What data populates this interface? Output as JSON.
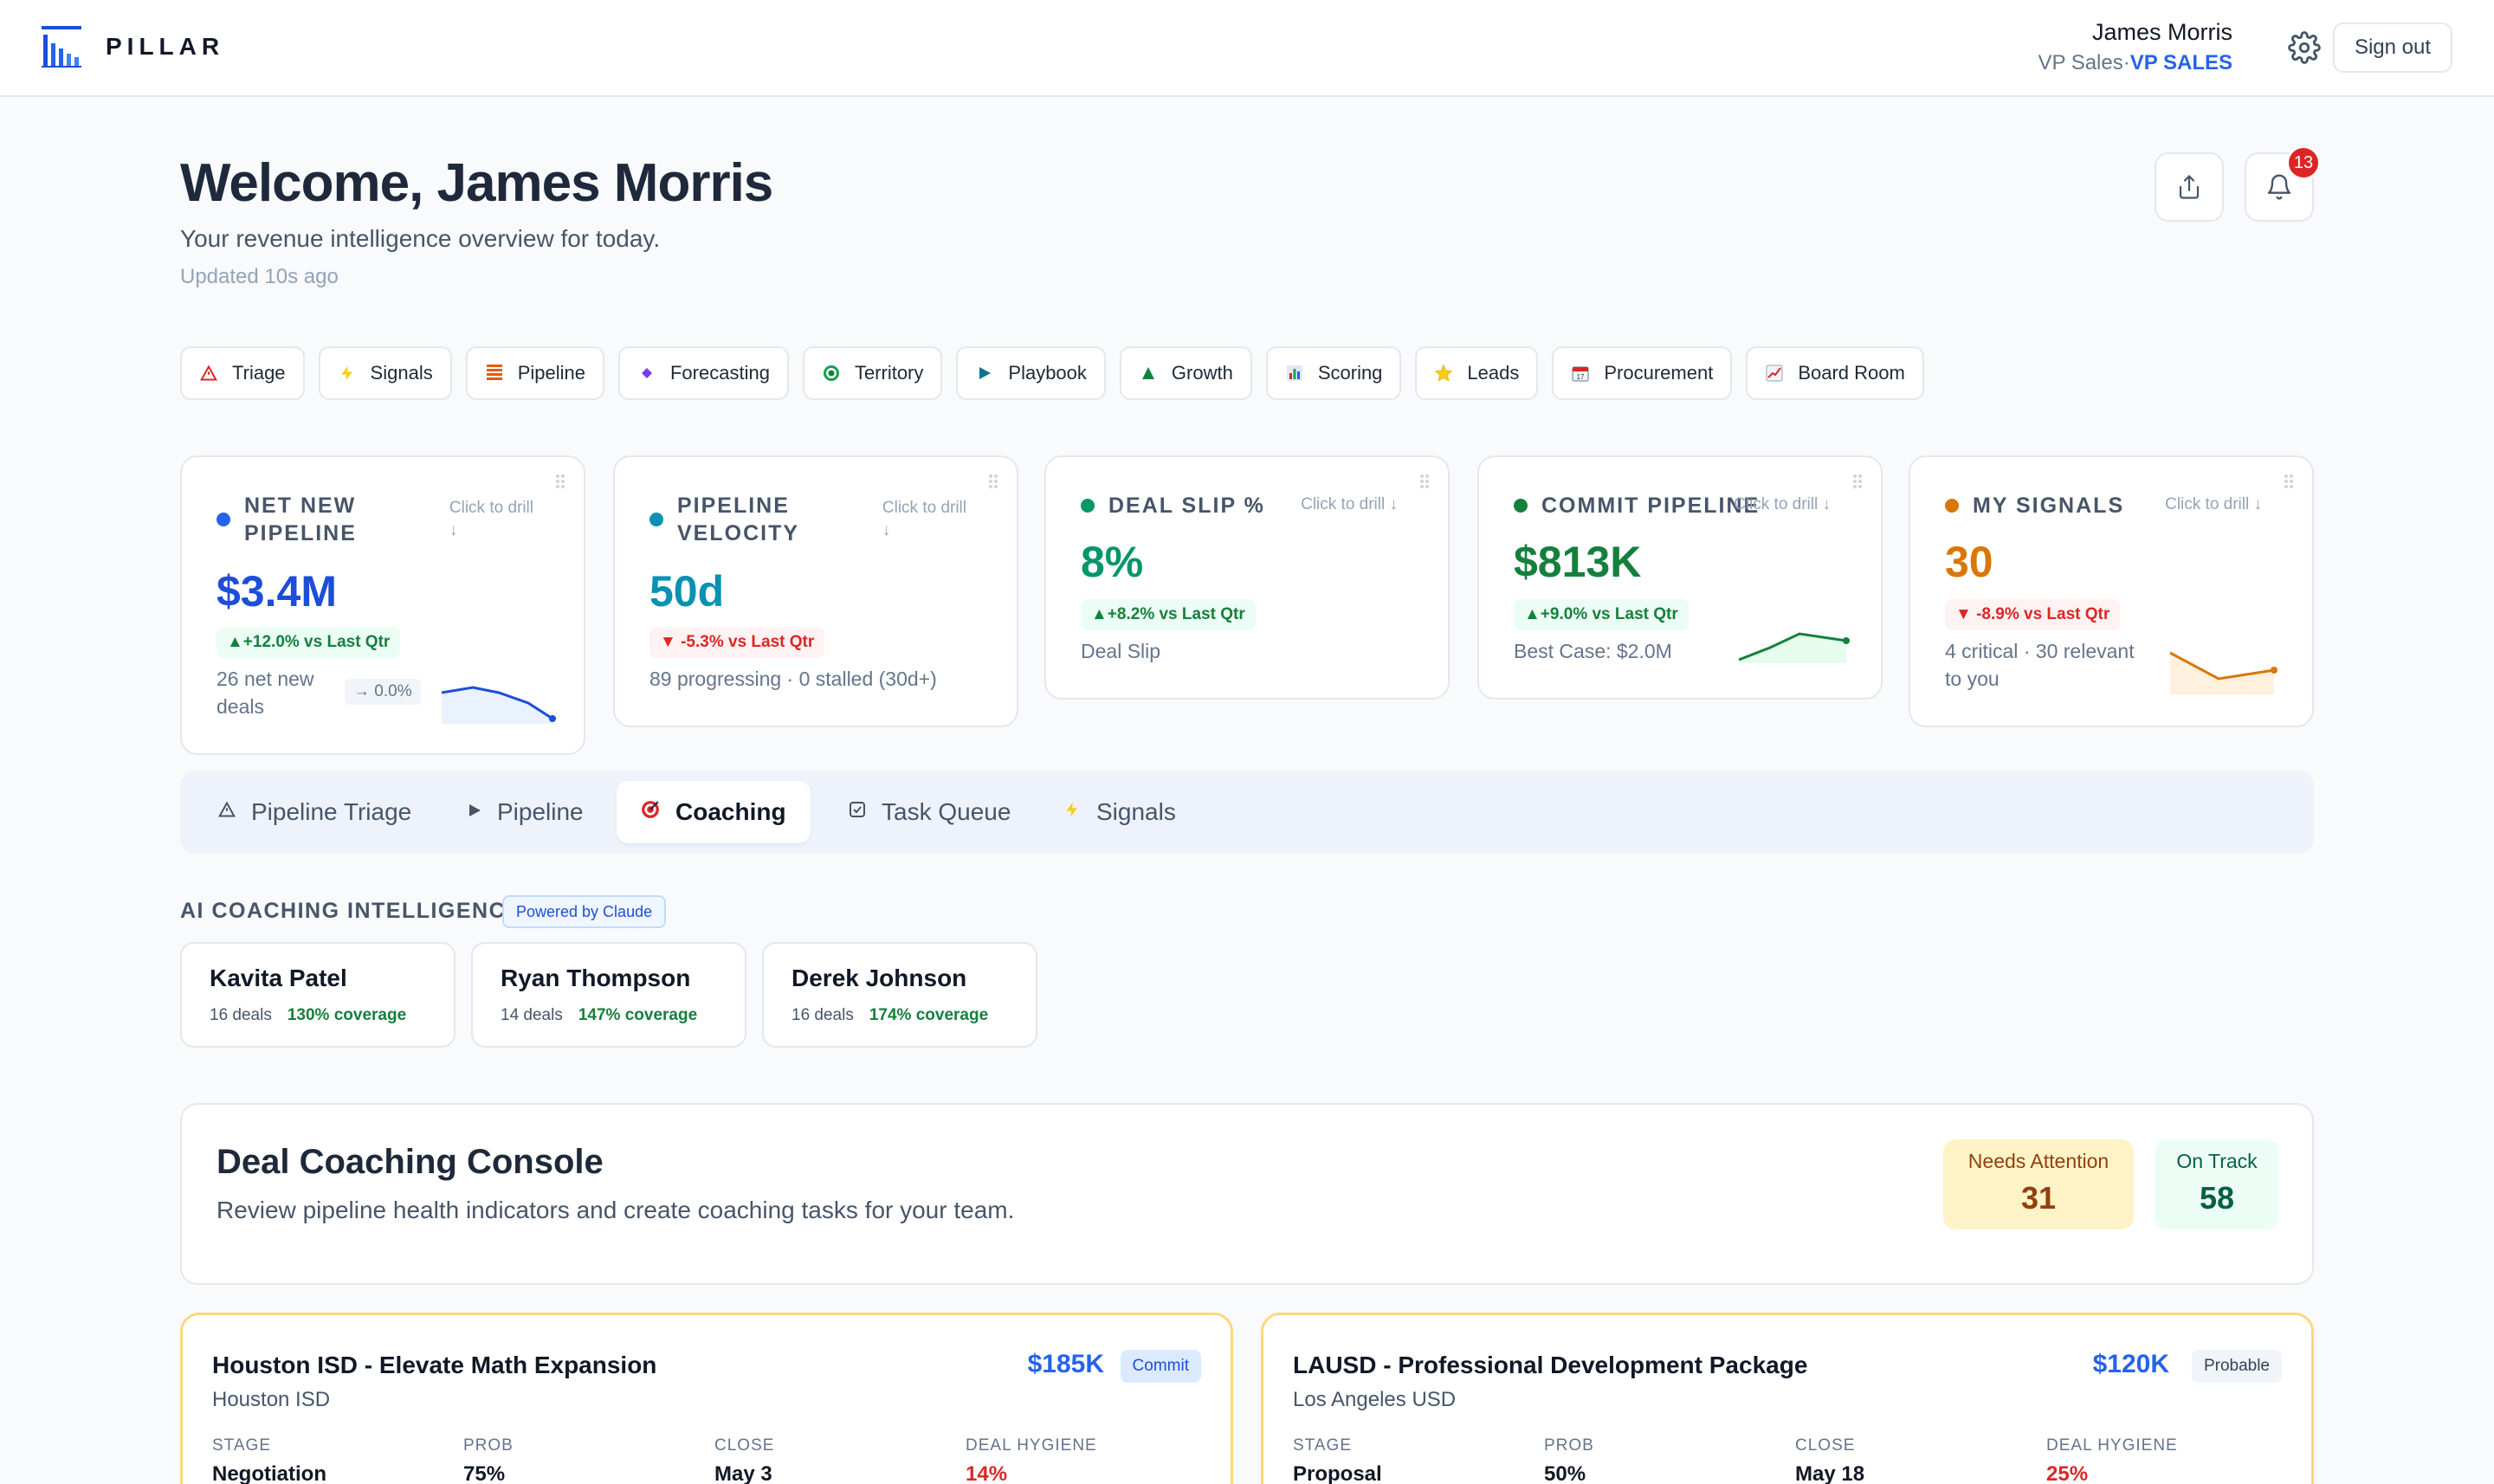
{
  "app": {
    "name": "PILLAR"
  },
  "user": {
    "name": "James Morris",
    "title": "VP Sales",
    "role": "VP SALES",
    "separator": "·"
  },
  "header": {
    "sign_out": "Sign out",
    "notifications": "13"
  },
  "welcome": {
    "title": "Welcome, James Morris",
    "subtitle": "Your revenue intelligence overview for today.",
    "updated": "Updated 10s ago"
  },
  "quick_links": [
    {
      "label": "Triage",
      "icon": "warning-icon"
    },
    {
      "label": "Signals",
      "icon": "lightning-icon"
    },
    {
      "label": "Pipeline",
      "icon": "bars-icon"
    },
    {
      "label": "Forecasting",
      "icon": "diamond-icon"
    },
    {
      "label": "Territory",
      "icon": "target-icon"
    },
    {
      "label": "Playbook",
      "icon": "play-icon"
    },
    {
      "label": "Growth",
      "icon": "triangle-up-icon"
    },
    {
      "label": "Scoring",
      "icon": "bar-chart-icon"
    },
    {
      "label": "Leads",
      "icon": "star-icon"
    },
    {
      "label": "Procurement",
      "icon": "calendar-icon"
    },
    {
      "label": "Board Room",
      "icon": "trend-chart-icon"
    }
  ],
  "kpis": [
    {
      "label_line1": "NET NEW",
      "label_line2": "PIPELINE",
      "drill_line1": "Click to drill",
      "drill_line2": "↓",
      "value": "$3.4M",
      "delta": "▲+12.0% vs Last Qtr",
      "note_line1": "26 net new",
      "note_line2": "deals",
      "mini": "→ 0.0%",
      "color": "#1d4ed8"
    },
    {
      "label_line1": "PIPELINE",
      "label_line2": "VELOCITY",
      "drill_line1": "Click to drill",
      "drill_line2": "↓",
      "value": "50d",
      "delta": "▼ -5.3% vs Last Qtr",
      "note": "89 progressing · 0 stalled (30d+)",
      "color": "#0891b2"
    },
    {
      "label": "DEAL SLIP %",
      "drill": "Click to drill ↓",
      "value": "8%",
      "delta": "▲+8.2% vs Last Qtr",
      "note": "Deal Slip",
      "color": "#0f9d58"
    },
    {
      "label": "COMMIT PIPELINE",
      "drill": "Click to drill ↓",
      "value": "$813K",
      "delta": "▲+9.0% vs Last Qtr",
      "note": "Best Case: $2.0M",
      "color": "#15803d"
    },
    {
      "label": "MY SIGNALS",
      "drill": "Click to drill ↓",
      "value": "30",
      "delta": "▼ -8.9% vs Last Qtr",
      "note_line1": "4 critical · 30 relevant",
      "note_line2": "to you",
      "color": "#d97706"
    }
  ],
  "tabs": [
    {
      "label": "Pipeline Triage",
      "icon": "warning-icon"
    },
    {
      "label": "Pipeline",
      "icon": "play-icon"
    },
    {
      "label": "Coaching",
      "icon": "target-icon",
      "active": true
    },
    {
      "label": "Task Queue",
      "icon": "checkbox-icon"
    },
    {
      "label": "Signals",
      "icon": "lightning-icon"
    }
  ],
  "ai_coaching": {
    "title": "AI COACHING INTELLIGENCE",
    "badge": "Powered by Claude",
    "reps": [
      {
        "name": "Kavita Patel",
        "deals": "16 deals",
        "coverage": "130% coverage"
      },
      {
        "name": "Ryan Thompson",
        "deals": "14 deals",
        "coverage": "147% coverage"
      },
      {
        "name": "Derek Johnson",
        "deals": "16 deals",
        "coverage": "174% coverage"
      }
    ]
  },
  "console": {
    "title": "Deal Coaching Console",
    "subtitle": "Review pipeline health indicators and create coaching tasks for your team.",
    "needs_attention_label": "Needs Attention",
    "needs_attention_value": "31",
    "on_track_label": "On Track",
    "on_track_value": "58"
  },
  "deals": [
    {
      "title": "Houston ISD - Elevate Math Expansion",
      "org": "Houston ISD",
      "amount": "$185K",
      "category": "Commit",
      "stage_label": "STAGE",
      "stage": "Negotiation",
      "prob_label": "PROB",
      "prob": "75%",
      "close_label": "CLOSE",
      "close": "May 3",
      "hygiene_label": "DEAL HYGIENE",
      "hygiene": "14%"
    },
    {
      "title": "LAUSD - Professional Development Package",
      "org": "Los Angeles USD",
      "amount": "$120K",
      "category": "Probable",
      "stage_label": "STAGE",
      "stage": "Proposal",
      "prob_label": "PROB",
      "prob": "50%",
      "close_label": "CLOSE",
      "close": "May 18",
      "hygiene_label": "DEAL HYGIENE",
      "hygiene": "25%"
    }
  ]
}
